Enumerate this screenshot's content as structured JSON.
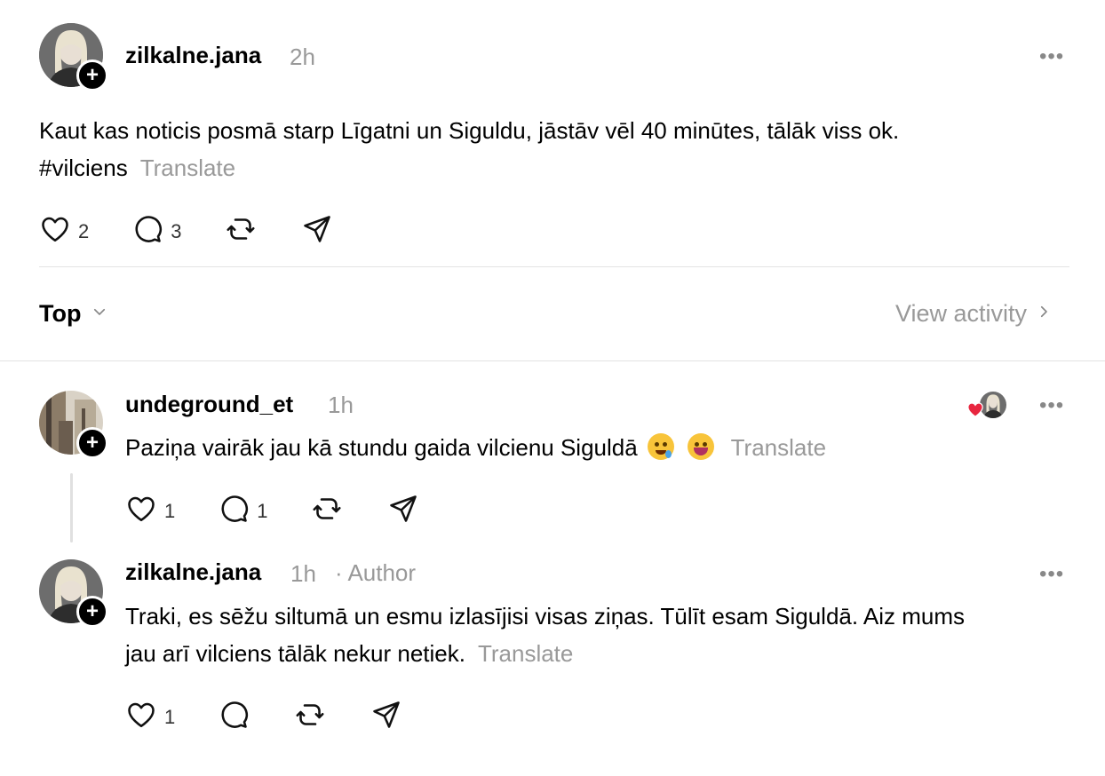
{
  "post": {
    "username": "zilkalne.jana",
    "time": "2h",
    "text_line1": "Kaut kas noticis posmā starp Līgatni un Siguldu, jāstāv vēl 40 minūtes, tālāk viss ok.",
    "hashtag": "#vilciens",
    "translate": "Translate",
    "likes": "2",
    "replies": "3"
  },
  "sort": {
    "label": "Top",
    "view_activity": "View activity"
  },
  "comments": [
    {
      "username": "undeground_et",
      "time": "1h",
      "text": "Paziņa vairāk jau kā stundu gaida vilcienu Siguldā",
      "translate": "Translate",
      "likes": "1",
      "replies": "1"
    },
    {
      "username": "zilkalne.jana",
      "time": "1h",
      "author_badge": "· Author",
      "text_line1": "Traki, es sēžu siltumā un esmu izlasījisi visas ziņas. Tūlīt esam Siguldā. Aiz mums",
      "text_line2": "jau arī vilciens tālāk nekur netiek.",
      "translate": "Translate",
      "likes": "1"
    }
  ],
  "icons": {
    "more": "more-dots-icon",
    "like": "heart-icon",
    "reply": "comment-bubble-icon",
    "repost": "repost-icon",
    "share": "send-icon"
  },
  "colors": {
    "secondary_text": "#999999",
    "divider": "#e3e3e3",
    "liked_heart": "#e8263f"
  }
}
